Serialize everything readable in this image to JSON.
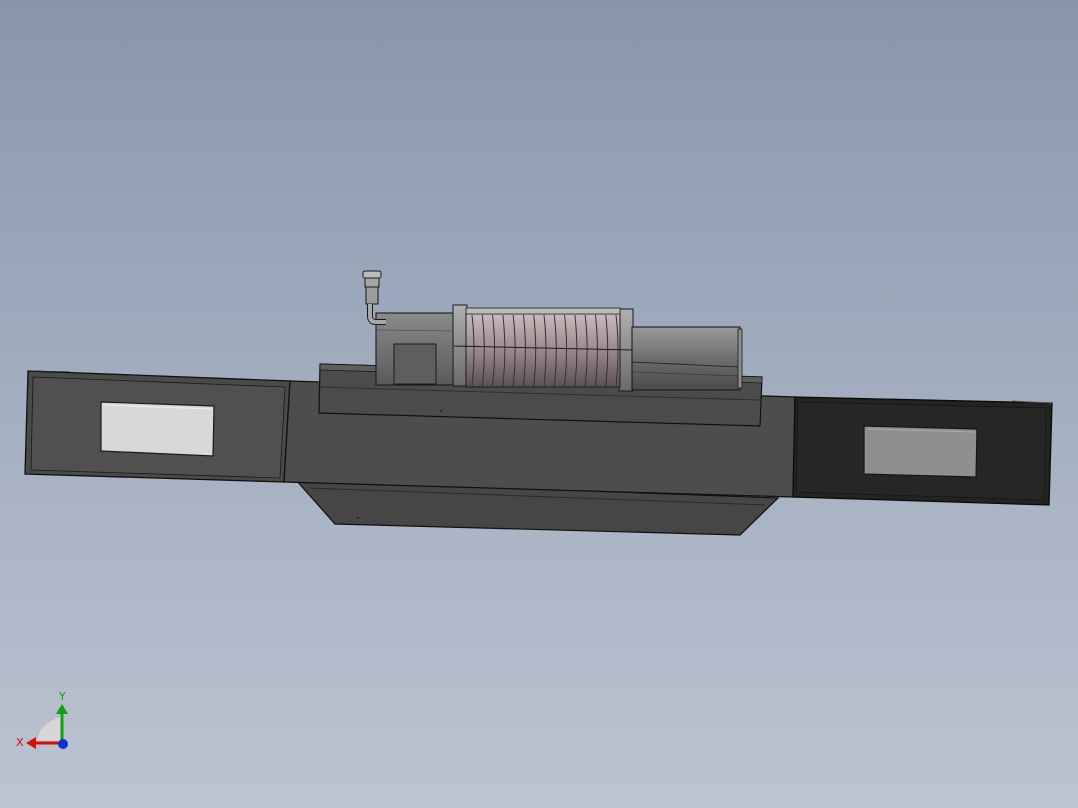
{
  "viewport": {
    "background_top": "#8796ac",
    "background_bottom": "#bcc4d2"
  },
  "model": {
    "parts": [
      "bumper-body",
      "winch-mount-plate",
      "winch-motor",
      "winch-drum",
      "winch-gearbox",
      "breather-fitting",
      "light-cutout-left",
      "light-cutout-right",
      "skid-plate"
    ],
    "colors": {
      "body": "#4e4e4e",
      "body_dark": "#252525",
      "edge": "#101010",
      "light_left": "#d8d8d8",
      "light_right": "#8f8f8f",
      "drum": "#9a8a8c",
      "motor": "#7a7a7a"
    }
  },
  "triad": {
    "x_label": "X",
    "y_label": "Y",
    "x_color": "#d01010",
    "y_color": "#10a010",
    "z_color": "#1030d0"
  }
}
